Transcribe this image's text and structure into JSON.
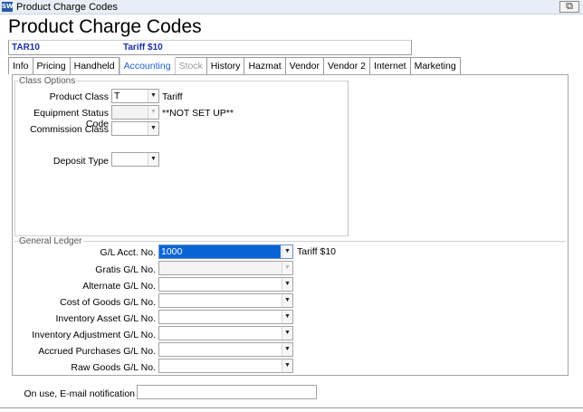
{
  "window": {
    "title": "Product Charge Codes",
    "icon": "app-icon",
    "restore_label": "⧉"
  },
  "page": {
    "title": "Product Charge Codes"
  },
  "record": {
    "code": "TAR10",
    "description": "Tariff $10"
  },
  "tabs": [
    {
      "label": "Info",
      "state": "normal"
    },
    {
      "label": "Pricing",
      "state": "normal"
    },
    {
      "label": "Handheld",
      "state": "normal"
    },
    {
      "label": "Accounting",
      "state": "active"
    },
    {
      "label": "Stock",
      "state": "disabled"
    },
    {
      "label": "History",
      "state": "normal"
    },
    {
      "label": "Hazmat",
      "state": "normal"
    },
    {
      "label": "Vendor",
      "state": "normal"
    },
    {
      "label": "Vendor 2",
      "state": "normal"
    },
    {
      "label": "Internet",
      "state": "normal"
    },
    {
      "label": "Marketing",
      "state": "normal"
    }
  ],
  "class_options": {
    "legend": "Class Options",
    "product_class": {
      "label": "Product Class",
      "value": "T",
      "note": "Tariff"
    },
    "equipment_status": {
      "label": "Equipment Status Code",
      "value": "",
      "note": "**NOT SET UP**"
    },
    "commission_class": {
      "label": "Commission Class",
      "value": ""
    },
    "deposit_type": {
      "label": "Deposit Type",
      "value": ""
    }
  },
  "general_ledger": {
    "legend": "General Ledger",
    "gl_acct": {
      "label": "G/L Acct. No.",
      "value": "1000",
      "note": "Tariff $10"
    },
    "gratis_gl": {
      "label": "Gratis G/L No.",
      "value": ""
    },
    "alternate_gl": {
      "label": "Alternate G/L No.",
      "value": ""
    },
    "cogs_gl": {
      "label": "Cost of Goods G/L No.",
      "value": ""
    },
    "inventory_asset_gl": {
      "label": "Inventory Asset G/L No.",
      "value": ""
    },
    "inventory_adjustment_gl": {
      "label": "Inventory Adjustment G/L No.",
      "value": ""
    },
    "accrued_purchases_gl": {
      "label": "Accrued Purchases G/L No.",
      "value": ""
    },
    "raw_goods_gl": {
      "label": "Raw Goods G/L No.",
      "value": ""
    }
  },
  "notification": {
    "label": "On use, E-mail notification",
    "value": ""
  },
  "colors": {
    "record_text": "#1a2fa8",
    "active_tab": "#1a5fd0",
    "selection": "#0a64d6"
  }
}
